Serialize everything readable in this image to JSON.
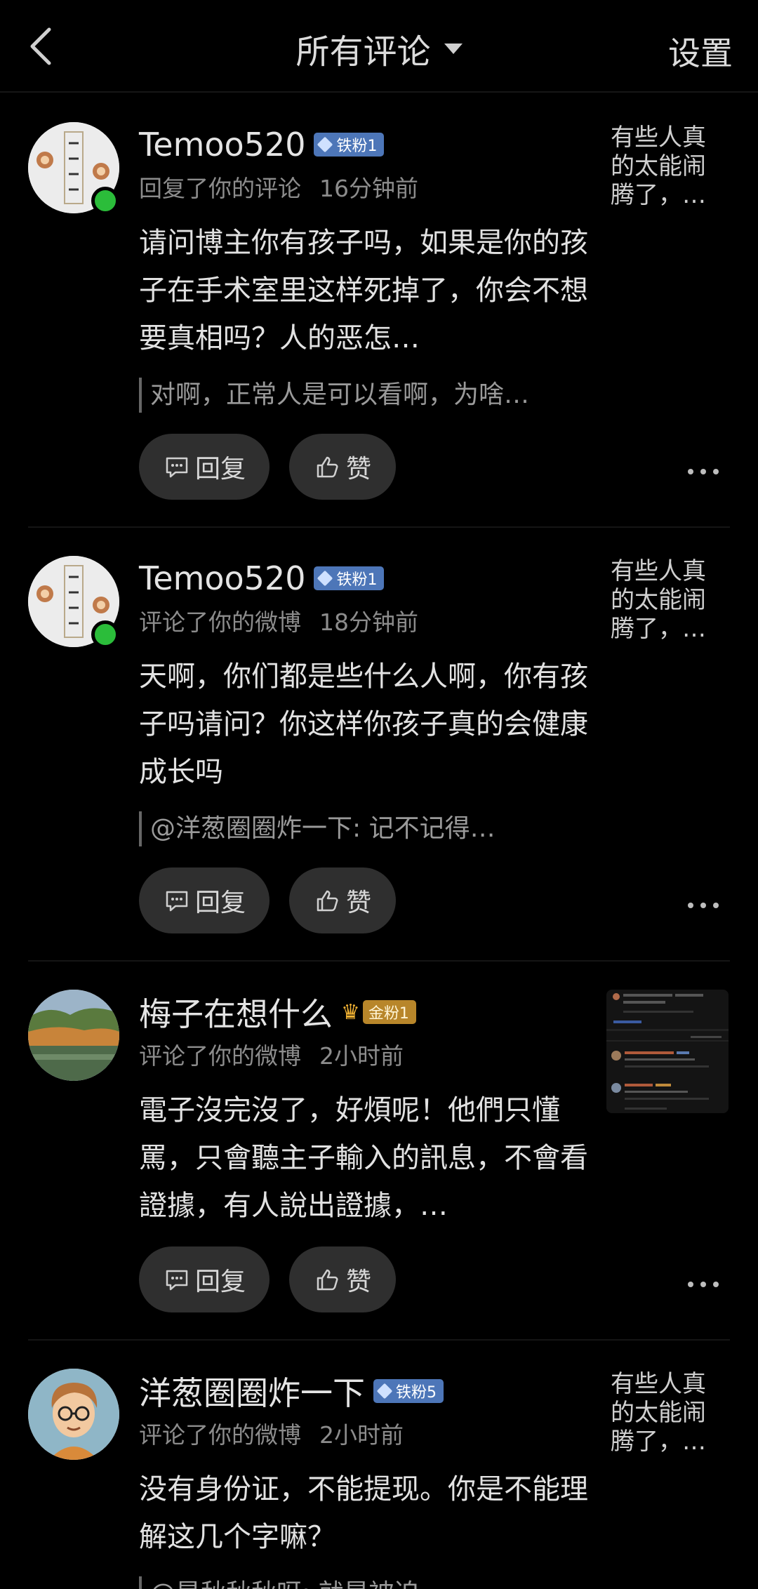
{
  "header": {
    "back_icon": "chevron-left-icon",
    "title": "所有评论",
    "settings_label": "设置"
  },
  "actions": {
    "reply_label": "回复",
    "like_label": "赞"
  },
  "comments": [
    {
      "username": "Temoo520",
      "badge": "铁粉1",
      "action": "回复了你的评论",
      "time": "16分钟前",
      "text": "请问博主你有孩子吗，如果是你的孩子在手术室里这样死掉了，你会不想要真相吗？人的恶怎…",
      "quote": "对啊，正常人是可以看啊，为啥…",
      "side_text": "有些人真的太能闹腾了，…",
      "online": true
    },
    {
      "username": "Temoo520",
      "badge": "铁粉1",
      "action": "评论了你的微博",
      "time": "18分钟前",
      "text": "天啊，你们都是些什么人啊，你有孩子吗请问？你这样你孩子真的会健康成长吗",
      "quote": "@洋葱圈圈炸一下:  记不记得…",
      "side_text": "有些人真的太能闹腾了，…",
      "online": true
    },
    {
      "username": "梅子在想什么",
      "badge": "金粉1",
      "action": "评论了你的微博",
      "time": "2小时前",
      "text": "電子沒完沒了，好煩呢！他們只懂罵，只會聽主子輸入的訊息，不會看證據，有人說出證據，…",
      "side_thumb": "screenshot-thumbnail"
    },
    {
      "username": "洋葱圈圈炸一下",
      "badge": "铁粉5",
      "action": "评论了你的微博",
      "time": "2小时前",
      "text": "没有身份证，不能提现。你是不能理解这几个字嘛？",
      "quote": "@是秋秋秋呀:  就是被迫…",
      "side_text": "有些人真的太能闹腾了，…"
    }
  ],
  "colors": {
    "background": "#000000",
    "online": "#2bbd3a",
    "iron_badge": "#4d76b8",
    "gold_badge": "#b8862a"
  }
}
